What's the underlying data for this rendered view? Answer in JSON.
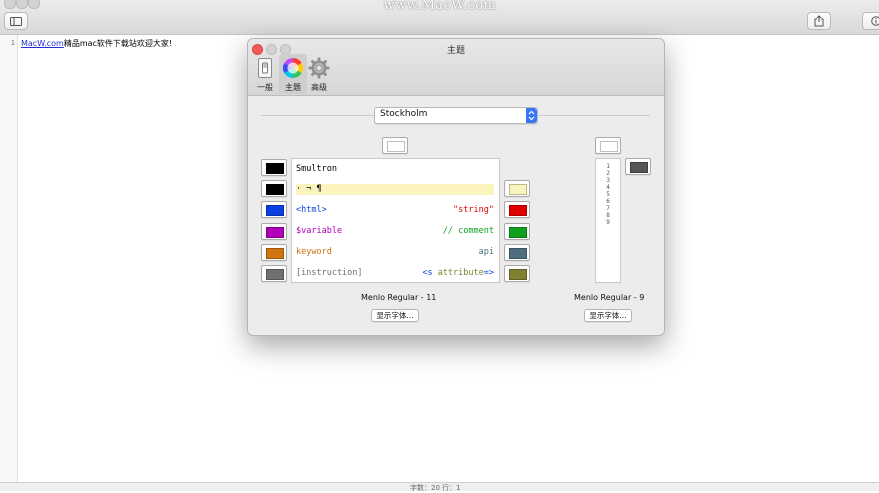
{
  "watermark": "www.MacW.com",
  "editor": {
    "line_number": "1",
    "link_text": "MacW.com",
    "text_after": "精品mac软件下载站欢迎大家!"
  },
  "statusbar": {
    "text": "字数：20    行：1"
  },
  "icons": {
    "sidebar_toggle": "sidebar-icon",
    "share": "share-icon",
    "info": "info-icon",
    "general": "light-switch-icon",
    "themes": "color-wheel-icon",
    "advanced": "gear-icon"
  },
  "prefs": {
    "title": "主题",
    "tabs": {
      "general": "一般",
      "themes": "主题",
      "advanced": "高级"
    },
    "theme_select": "Stockholm",
    "code": {
      "title": "Smultron",
      "invisibles": "·  ¬  ¶",
      "html": "<html>",
      "string": "\"string\"",
      "variable": "$variable",
      "comment": "// comment",
      "keyword": "keyword",
      "api": "api",
      "instruction": "[instruction]",
      "attr_open": "<s ",
      "attr_name": "attribute",
      "attr_close": "=>"
    },
    "gutter_lines": [
      "1",
      "2",
      "3",
      "4",
      "5",
      "6",
      "7",
      "8",
      "9"
    ],
    "editor_font": "Menlo Regular - 11",
    "gutter_font": "Menlo Regular - 9",
    "show_fonts": "显示字体...",
    "colors": {
      "text": "#000000",
      "invisibles": "#000000",
      "tag": "#0a3fe0",
      "variable": "#b000b8",
      "keyword": "#d07410",
      "instruction": "#707070",
      "background": "#ffffff",
      "selection": "#faf3be",
      "string": "#e00000",
      "comment": "#10a020",
      "api": "#4f6d80",
      "attribute": "#808030",
      "gutter_background": "#ffffff",
      "gutter_text": "#555555"
    }
  }
}
